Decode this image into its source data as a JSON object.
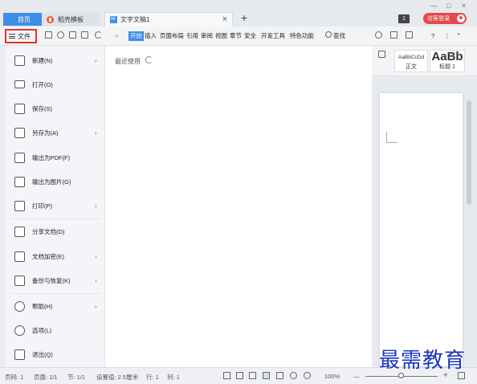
{
  "titlebar": {
    "tabs": [
      {
        "label": "首页"
      },
      {
        "label": "稻壳模板"
      },
      {
        "label": "文字文稿1"
      }
    ],
    "close_glyph": "×",
    "add_glyph": "+",
    "window_controls": [
      "—",
      "□",
      "×"
    ],
    "badge": "1",
    "login_label": "访客登录"
  },
  "toolbar": {
    "file_label": "文件",
    "ribbon_tabs": [
      "开始",
      "插入",
      "页面布局",
      "引用",
      "审阅",
      "视图",
      "章节",
      "安全",
      "开发工具",
      "特色功能"
    ],
    "search_label": "查找",
    "more_glyph": "»",
    "help_glyph": "?"
  },
  "ribbon_styles": {
    "normal_preview": "AaBbCcDd",
    "normal_label": "正文",
    "heading_preview": "AaBb",
    "heading_label": "标题 1"
  },
  "file_menu": {
    "items": [
      {
        "label": "新建(N)",
        "icon": "new-doc-icon",
        "submenu": true
      },
      {
        "label": "打开(O)",
        "icon": "folder-open-icon",
        "submenu": false
      },
      {
        "label": "保存(S)",
        "icon": "save-icon",
        "submenu": false
      },
      {
        "label": "另存为(A)",
        "icon": "save-as-icon",
        "submenu": true
      },
      {
        "label": "输出为PDF(F)",
        "icon": "pdf-export-icon",
        "submenu": false
      },
      {
        "label": "输出为图片(G)",
        "icon": "image-export-icon",
        "submenu": false
      },
      {
        "label": "打印(P)",
        "icon": "printer-icon",
        "submenu": true
      },
      {
        "label": "分享文档(D)",
        "icon": "share-icon",
        "submenu": false
      },
      {
        "label": "文档加密(E)",
        "icon": "lock-doc-icon",
        "submenu": true
      },
      {
        "label": "备份与恢复(K)",
        "icon": "backup-icon",
        "submenu": true
      },
      {
        "label": "帮助(H)",
        "icon": "help-icon",
        "submenu": true
      },
      {
        "label": "选项(L)",
        "icon": "settings-icon",
        "submenu": false
      },
      {
        "label": "退出(Q)",
        "icon": "exit-icon",
        "submenu": false
      }
    ],
    "arrow_glyph": "›",
    "recent_title": "最近使用"
  },
  "statusbar": {
    "page": "页码: 1",
    "pages": "页面: 1/1",
    "section": "节: 1/1",
    "position": "设置值: 2.5厘米",
    "row": "行: 1",
    "col": "列: 1",
    "zoom": "100%",
    "zoom_minus": "—",
    "zoom_plus": "+"
  },
  "watermark": "最需教育",
  "colors": {
    "accent": "#3d8de8",
    "highlight_border": "#e03434",
    "login": "#e24a4a",
    "watermark": "#1b35b8"
  }
}
